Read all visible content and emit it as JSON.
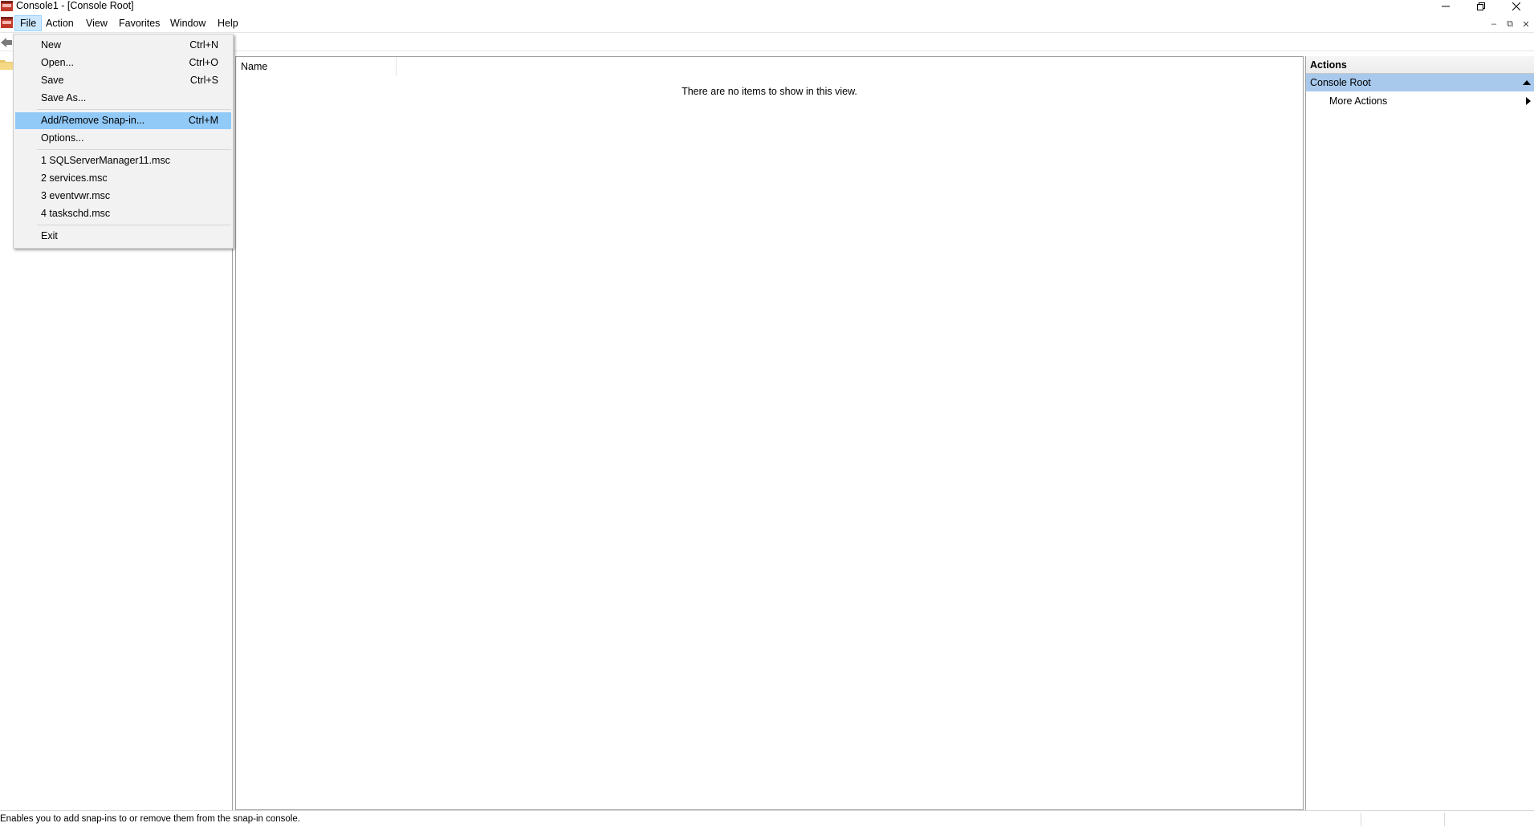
{
  "window": {
    "title": "Console1 - [Console Root]",
    "controls": [
      "minimize-icon",
      "restore-icon",
      "close-icon"
    ]
  },
  "menubar": {
    "items": [
      "File",
      "Action",
      "View",
      "Favorites",
      "Window",
      "Help"
    ],
    "active": "File"
  },
  "file_menu": {
    "items": [
      {
        "label": "New",
        "shortcut": "Ctrl+N"
      },
      {
        "label": "Open...",
        "shortcut": "Ctrl+O"
      },
      {
        "label": "Save",
        "shortcut": "Ctrl+S"
      },
      {
        "label": "Save As...",
        "shortcut": ""
      },
      {
        "label": "Add/Remove Snap-in...",
        "shortcut": "Ctrl+M"
      },
      {
        "label": "Options...",
        "shortcut": ""
      },
      {
        "label": "1 SQLServerManager11.msc",
        "shortcut": ""
      },
      {
        "label": "2 services.msc",
        "shortcut": ""
      },
      {
        "label": "3 eventvwr.msc",
        "shortcut": ""
      },
      {
        "label": "4 taskschd.msc",
        "shortcut": ""
      },
      {
        "label": "Exit",
        "shortcut": ""
      }
    ],
    "highlighted": "Add/Remove Snap-in..."
  },
  "list": {
    "column_name": "Name",
    "empty_message": "There are no items to show in this view."
  },
  "actions": {
    "header": "Actions",
    "section": "Console Root",
    "more_actions": "More Actions"
  },
  "status": {
    "text": "Enables you to add snap-ins to or remove them from the snap-in console."
  },
  "colors": {
    "menu_highlight": "#91c9f7",
    "actions_section": "#a8c9ec",
    "menu_active": "#cce8ff"
  }
}
